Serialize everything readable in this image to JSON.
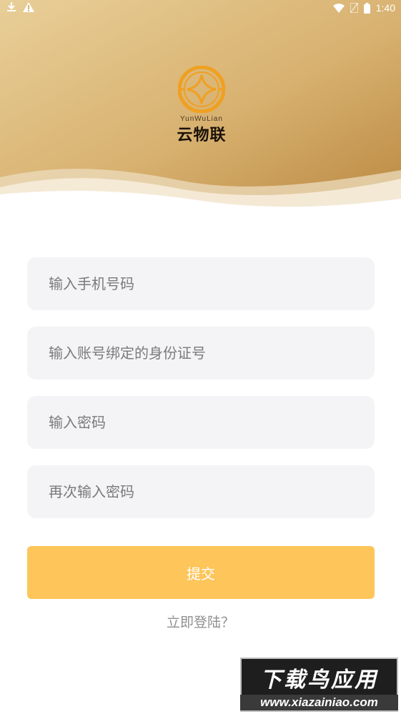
{
  "status_bar": {
    "time": "1:40",
    "icons": [
      "download-icon",
      "warning-icon",
      "wifi-icon",
      "no-sim-icon",
      "battery-icon"
    ]
  },
  "brand": {
    "name_en": "YunWuLian",
    "name_cn": "云物联"
  },
  "form": {
    "phone_placeholder": "输入手机号码",
    "id_placeholder": "输入账号绑定的身份证号",
    "password_placeholder": "输入密码",
    "confirm_password_placeholder": "再次输入密码",
    "submit_label": "提交",
    "login_link": "立即登陆？"
  },
  "watermark": {
    "title": "下载鸟应用",
    "url": "www.xiazainiao.com"
  },
  "colors": {
    "header_gold": "#c89a56",
    "header_light": "#e6c98f",
    "input_bg": "#f4f4f6",
    "button": "#fdc55a",
    "link_text": "#8f8f8f"
  }
}
